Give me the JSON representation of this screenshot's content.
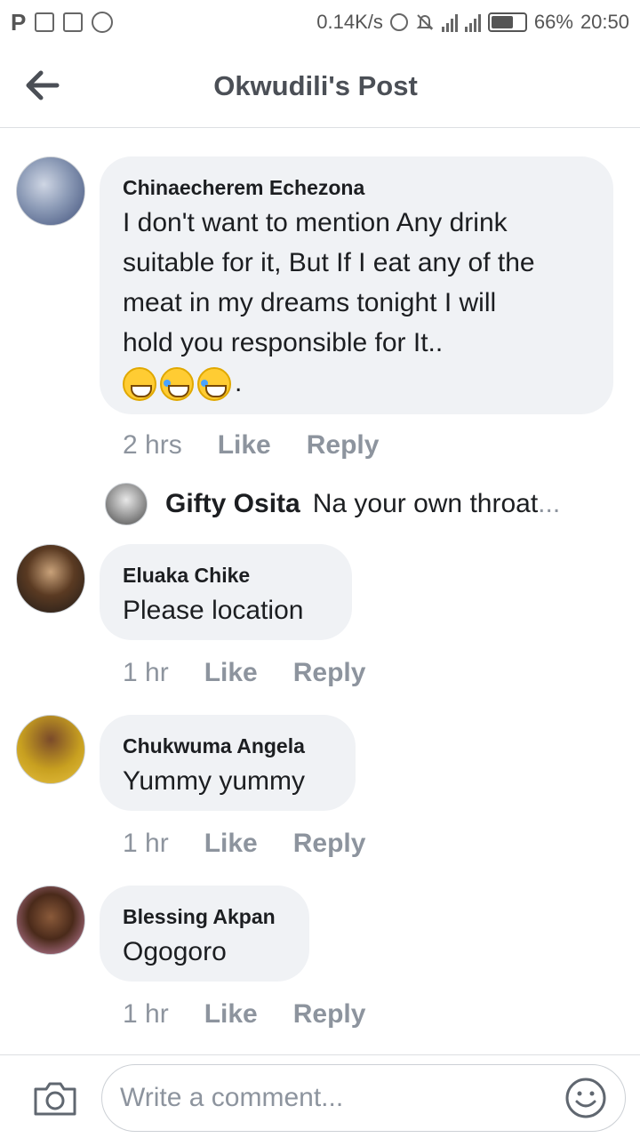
{
  "status_bar": {
    "speed": "0.14K/s",
    "battery": "66%",
    "battery_level": 0.66,
    "time": "20:50",
    "left_icons": [
      "p-icon",
      "screenshot-icon",
      "sim-icon",
      "whatsapp-icon"
    ],
    "right_icons": [
      "sync-icon",
      "mute-icon",
      "signal-icon",
      "h-signal-icon",
      "battery-icon"
    ]
  },
  "header": {
    "title": "Okwudili's Post",
    "back_icon": "arrow-left-icon"
  },
  "comments": [
    {
      "name": "Chinaecherem Echezona",
      "lines": [
        "I don't want to mention Any drink",
        "suitable for it, But If I eat any of the",
        "meat in my dreams tonight I will",
        "hold you  responsible for It.."
      ],
      "emoji_suffix": ".",
      "emojis": [
        "grinning-emoji",
        "tears-of-joy-emoji",
        "tears-of-joy-emoji"
      ],
      "time": "2 hrs",
      "like": "Like",
      "reply": "Reply"
    },
    {
      "name": "Eluaka Chike",
      "text": "Please location",
      "time": "1 hr",
      "like": "Like",
      "reply": "Reply"
    },
    {
      "name": "Chukwuma Angela",
      "text": "Yummy yummy",
      "time": "1 hr",
      "like": "Like",
      "reply": "Reply"
    },
    {
      "name": "Blessing Akpan",
      "text": "Ogogoro",
      "time": "1 hr",
      "like": "Like",
      "reply": "Reply"
    }
  ],
  "reply_preview": {
    "name": "Gifty Osita",
    "text": "Na your own throat",
    "ellipsis": "..."
  },
  "composer": {
    "placeholder": "Write a comment...",
    "camera_icon": "camera-icon",
    "emoji_icon": "smiley-icon"
  }
}
